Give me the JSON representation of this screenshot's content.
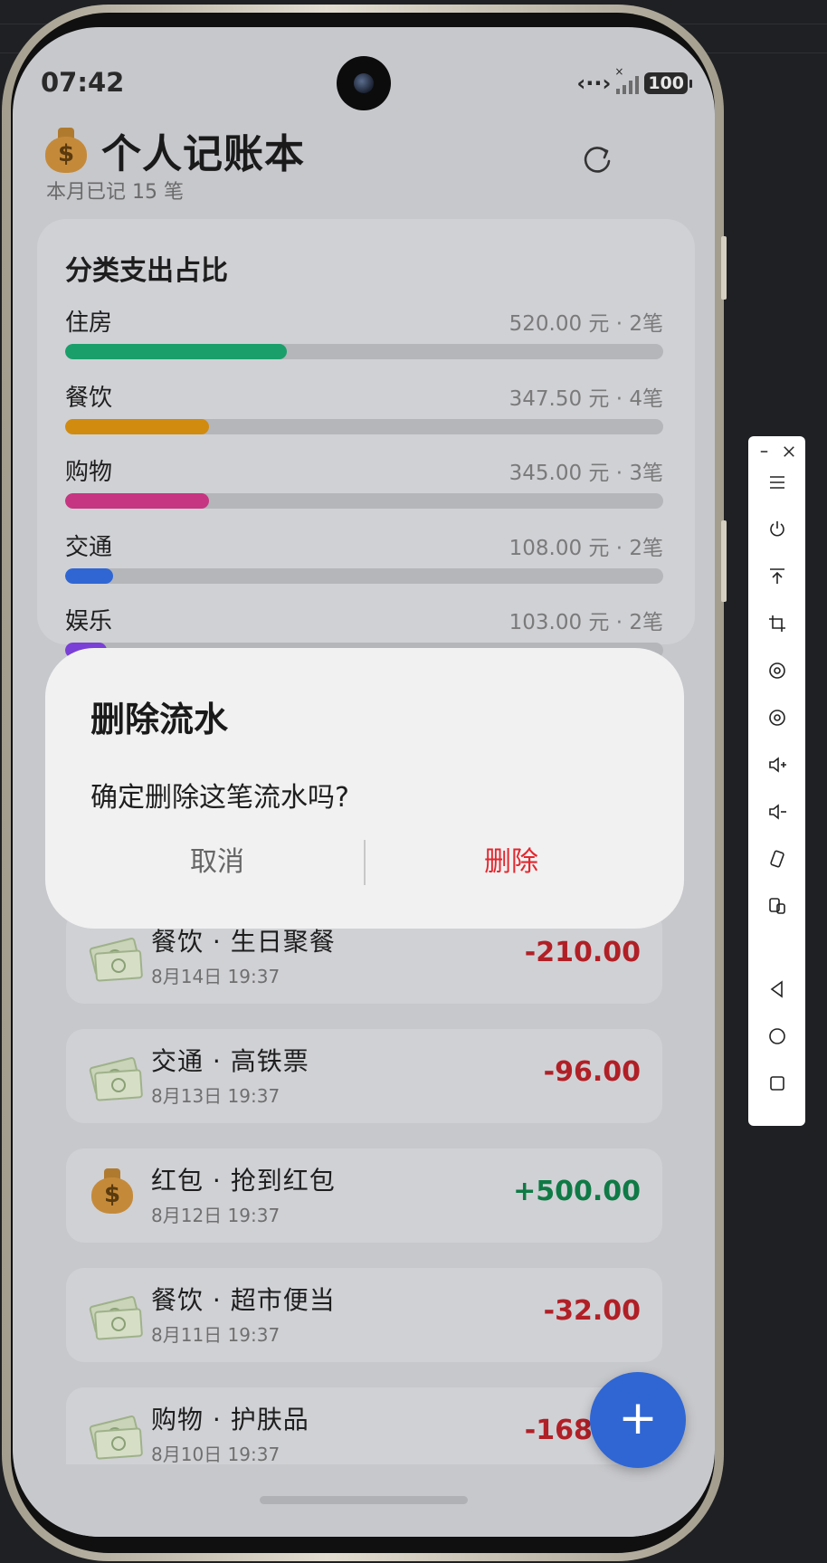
{
  "status_bar": {
    "time": "07:42",
    "battery": "100"
  },
  "header": {
    "title": "个人记账本",
    "subtitle": "本月已记 15 笔"
  },
  "categories": {
    "title": "分类支出占比",
    "items": [
      {
        "name": "住房",
        "amount": "520.00 元 · 2笔",
        "share": 0.37,
        "color": "#1a9f6b"
      },
      {
        "name": "餐饮",
        "amount": "347.50 元 · 4笔",
        "share": 0.24,
        "color": "#d18b0f"
      },
      {
        "name": "购物",
        "amount": "345.00 元 · 3笔",
        "share": 0.24,
        "color": "#c63581"
      },
      {
        "name": "交通",
        "amount": "108.00 元 · 2笔",
        "share": 0.08,
        "color": "#2f66d4"
      },
      {
        "name": "娱乐",
        "amount": "103.00 元 · 2笔",
        "share": 0.07,
        "color": "#7a3fd6"
      }
    ]
  },
  "transactions": [
    {
      "title": "餐饮 · 生日聚餐",
      "date": "8月14日 19:37",
      "amount": "-210.00",
      "type": "expense",
      "icon": "cash-icon"
    },
    {
      "title": "交通 · 高铁票",
      "date": "8月13日 19:37",
      "amount": "-96.00",
      "type": "expense",
      "icon": "cash-icon"
    },
    {
      "title": "红包 · 抢到红包",
      "date": "8月12日 19:37",
      "amount": "+500.00",
      "type": "income",
      "icon": "money-bag-icon"
    },
    {
      "title": "餐饮 · 超市便当",
      "date": "8月11日 19:37",
      "amount": "-32.00",
      "type": "expense",
      "icon": "cash-icon"
    },
    {
      "title": "购物 · 护肤品",
      "date": "8月10日 19:37",
      "amount": "-168.00",
      "type": "expense",
      "icon": "cash-icon"
    }
  ],
  "fab": {
    "label": "+"
  },
  "dialog": {
    "title": "删除流水",
    "message": "确定删除这笔流水吗?",
    "cancel_label": "取消",
    "confirm_label": "删除"
  }
}
